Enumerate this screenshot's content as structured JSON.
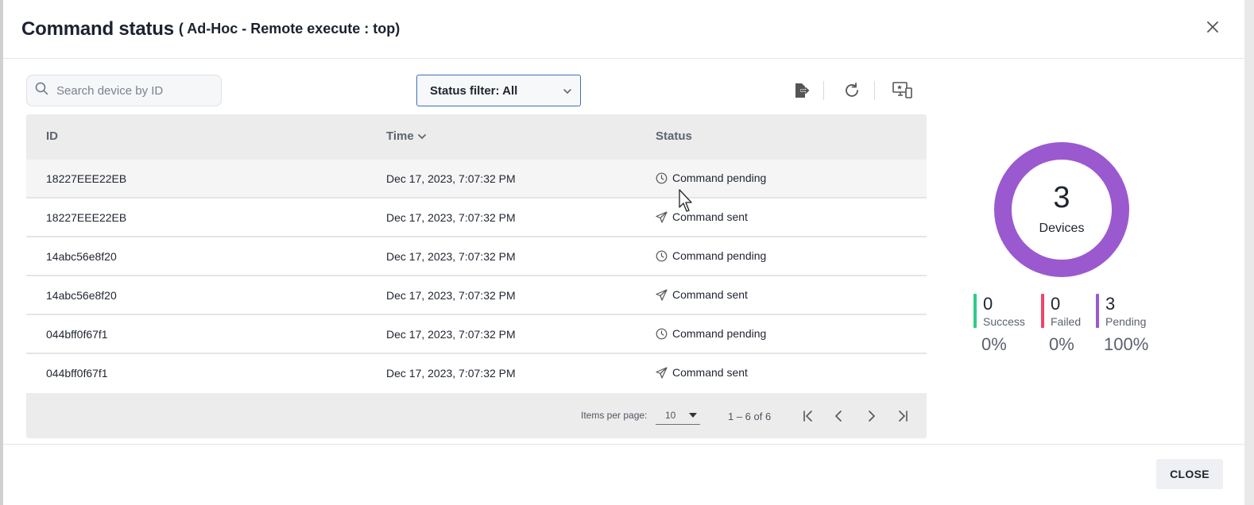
{
  "dialog": {
    "title": "Command status",
    "subtitle": "( Ad-Hoc - Remote execute : top)"
  },
  "toolbar": {
    "search_placeholder": "Search device by ID",
    "status_filter_label": "Status filter: All",
    "icons": [
      "export-icon",
      "refresh-icon",
      "device-screen-icon"
    ]
  },
  "table": {
    "columns": [
      "ID",
      "Time",
      "Status"
    ],
    "sorted_column": "Time",
    "rows": [
      {
        "id": "18227EEE22EB",
        "time": "Dec 17, 2023, 7:07:32 PM",
        "status": "Command pending",
        "icon": "clock-icon"
      },
      {
        "id": "18227EEE22EB",
        "time": "Dec 17, 2023, 7:07:32 PM",
        "status": "Command sent",
        "icon": "send-icon"
      },
      {
        "id": "14abc56e8f20",
        "time": "Dec 17, 2023, 7:07:32 PM",
        "status": "Command pending",
        "icon": "clock-icon"
      },
      {
        "id": "14abc56e8f20",
        "time": "Dec 17, 2023, 7:07:32 PM",
        "status": "Command sent",
        "icon": "send-icon"
      },
      {
        "id": "044bff0f67f1",
        "time": "Dec 17, 2023, 7:07:32 PM",
        "status": "Command pending",
        "icon": "clock-icon"
      },
      {
        "id": "044bff0f67f1",
        "time": "Dec 17, 2023, 7:07:32 PM",
        "status": "Command sent",
        "icon": "send-icon"
      }
    ]
  },
  "paginator": {
    "items_per_page_label": "Items per page:",
    "items_per_page": "10",
    "range_label": "1 – 6 of 6"
  },
  "summary": {
    "total": "3",
    "total_label": "Devices",
    "donut_color": "#9b59d0",
    "stats": [
      {
        "value": "0",
        "label": "Success",
        "percent": "0%",
        "color": "#2ecc8a"
      },
      {
        "value": "0",
        "label": "Failed",
        "percent": "0%",
        "color": "#f0436b"
      },
      {
        "value": "3",
        "label": "Pending",
        "percent": "100%",
        "color": "#9b59d0"
      }
    ]
  },
  "footer": {
    "close_label": "CLOSE"
  }
}
